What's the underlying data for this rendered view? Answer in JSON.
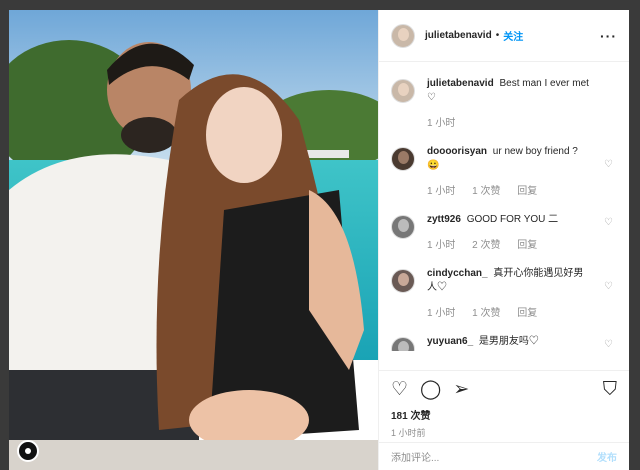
{
  "header": {
    "username": "julietabenavid",
    "dot": "•",
    "follow": "关注",
    "more": "···"
  },
  "caption": {
    "username": "julietabenavid",
    "text": "Best man I ever met",
    "heart": "♡",
    "time": "1 小时"
  },
  "comments": [
    {
      "username": "doooorisyan",
      "text": "ur new boy friend ?",
      "emoji": "😀",
      "time": "1 小时",
      "likes": "1 次赞",
      "reply": "回复"
    },
    {
      "username": "zytt926",
      "text": "GOOD FOR YOU ⼆",
      "time": "1 小时",
      "likes": "2 次赞",
      "reply": "回复"
    },
    {
      "username": "cindycchan_",
      "text": "真开心你能遇见好男人♡",
      "time": "1 小时",
      "likes": "1 次赞",
      "reply": "回复"
    },
    {
      "username": "yuyuan6_",
      "text": "是男朋友吗♡",
      "time": "",
      "likes": "",
      "reply": ""
    }
  ],
  "actions": {
    "like_icon": "heart-outline",
    "comment_icon": "speech-bubble",
    "share_icon": "paper-plane",
    "save_icon": "bookmark"
  },
  "likes": "181 次赞",
  "posted": "1 小时前",
  "add_comment": {
    "placeholder": "添加评论...",
    "post": "发布"
  }
}
